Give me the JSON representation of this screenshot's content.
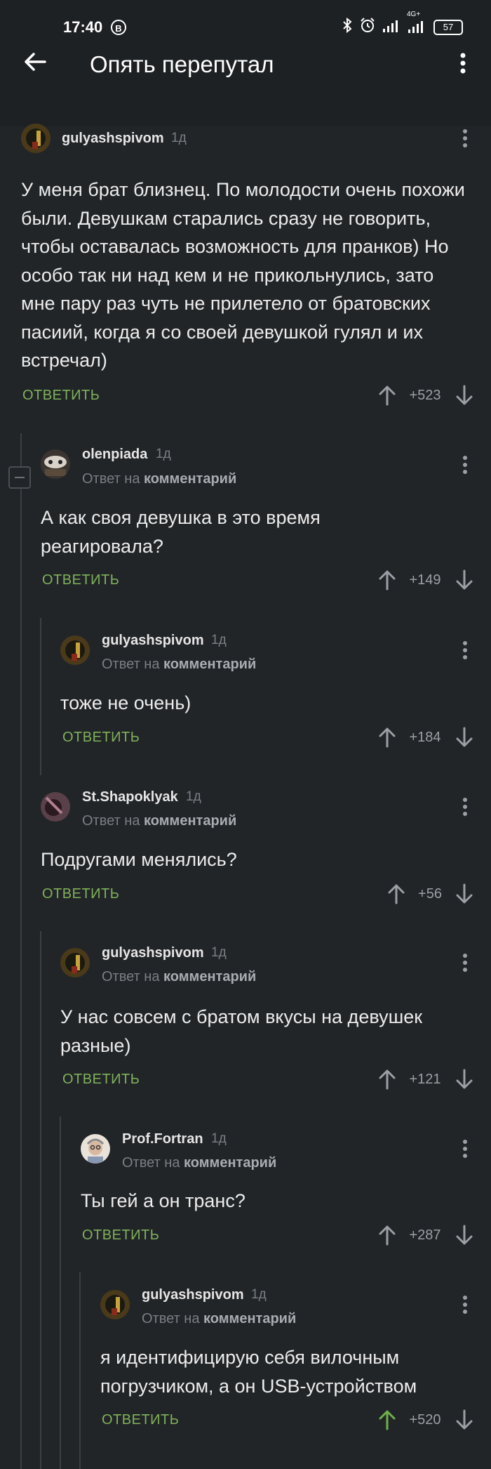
{
  "status": {
    "time": "17:40",
    "badge": "B",
    "network": "4G+",
    "battery": "57"
  },
  "header": {
    "title": "Опять перепутал"
  },
  "comments": [
    {
      "user": "gulyashspivom",
      "age": "1д",
      "reply_prefix": "",
      "reply_target": "",
      "text": "У меня брат близнец. По молодости очень похожи были. Девушкам старались сразу не говорить, чтобы оставалась возможность для пранков) Но особо так ни над кем и не прикольнулись, зато мне пару раз чуть не прилетело от братовских пасиий, когда я со своей девушкой гулял и их встречал)",
      "reply": "ОТВЕТИТЬ",
      "score": "+523"
    },
    {
      "user": "olenpiada",
      "age": "1д",
      "reply_prefix": "Ответ на",
      "reply_target": "комментарий",
      "text": "А как своя девушка в это время реагировала?",
      "reply": "ОТВЕТИТЬ",
      "score": "+149"
    },
    {
      "user": "gulyashspivom",
      "age": "1д",
      "reply_prefix": "Ответ на",
      "reply_target": "комментарий",
      "text": "тоже не очень)",
      "reply": "ОТВЕТИТЬ",
      "score": "+184"
    },
    {
      "user": "St.Shapoklyak",
      "age": "1д",
      "reply_prefix": "Ответ на",
      "reply_target": "комментарий",
      "text": "Подругами менялись?",
      "reply": "ОТВЕТИТЬ",
      "score": "+56"
    },
    {
      "user": "gulyashspivom",
      "age": "1д",
      "reply_prefix": "Ответ на",
      "reply_target": "комментарий",
      "text": "У нас совсем с братом вкусы на девушек разные)",
      "reply": "ОТВЕТИТЬ",
      "score": "+121"
    },
    {
      "user": "Prof.Fortran",
      "age": "1д",
      "reply_prefix": "Ответ на",
      "reply_target": "комментарий",
      "text": "Ты гей а он транс?",
      "reply": "ОТВЕТИТЬ",
      "score": "+287"
    },
    {
      "user": "gulyashspivom",
      "age": "1д",
      "reply_prefix": "Ответ на",
      "reply_target": "комментарий",
      "text": "я идентифицирую себя вилочным погрузчиком, а он USB-устройством",
      "reply": "ОТВЕТИТЬ",
      "score": "+520"
    }
  ],
  "colors": {
    "background": "#222528",
    "bar": "#1e2124",
    "accent_green": "#7fb15a",
    "upvoted_green": "#6fb04a",
    "muted": "#7a7f85"
  },
  "icons": [
    "back-arrow-icon",
    "overflow-menu-icon",
    "upvote-arrow-icon",
    "downvote-arrow-icon",
    "collapse-minus-icon"
  ]
}
